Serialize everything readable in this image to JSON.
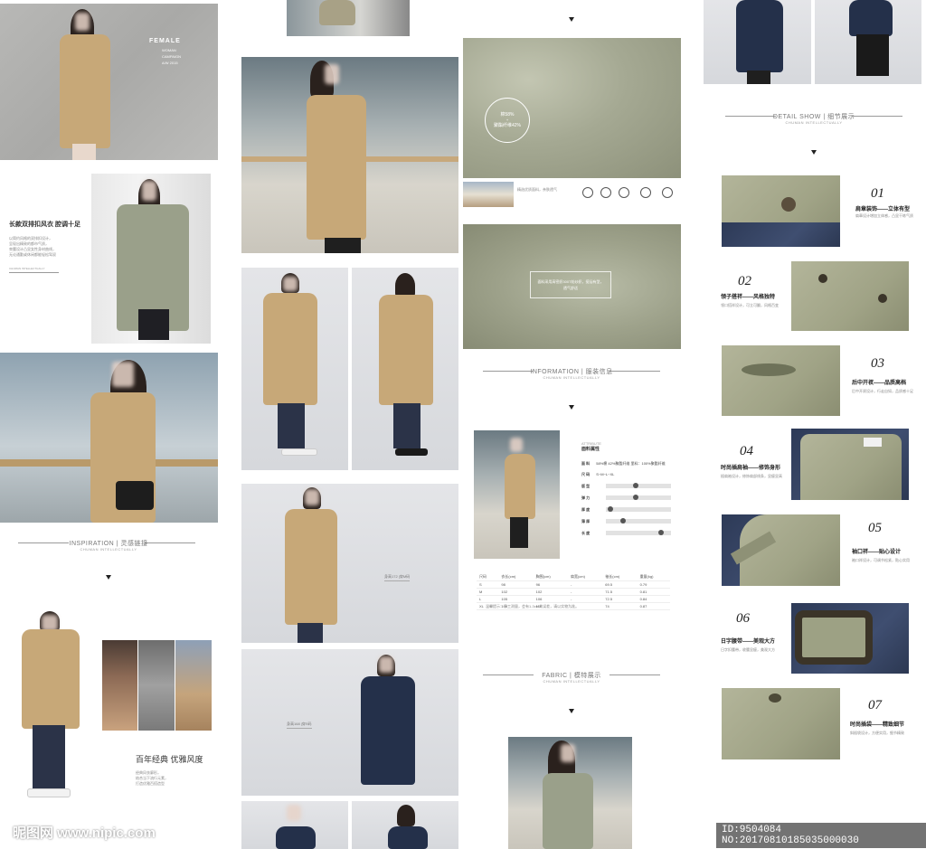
{
  "campaign": {
    "line1": "FEMALE",
    "line2": "WOMAN",
    "line3": "CAMPAIGN",
    "line4": "A/W 2015"
  },
  "intro": {
    "title": "长款双排扣风衣 腔调十足",
    "desc_lines": [
      "以简约风格的双排扣设计，",
      "呈现出精致的都市气质，",
      "束腰设计凸显女性身材曲线，",
      "无论通勤或休闲都能轻松驾驭"
    ],
    "brand_small": "CHUMAN INTELLECTUALLY"
  },
  "sections": {
    "inspiration": {
      "title": "INSPIRATION | 灵感链接",
      "sub": "CHUMAN INTELLECTUALLY"
    },
    "information": {
      "title": "INFORMATION | 服装信息",
      "sub": "CHUMAN INTELLECTUALLY"
    },
    "fabric": {
      "title": "FABRIC | 模特展示",
      "sub": "CHUMAN INTELLECTUALLY"
    },
    "detail": {
      "title": "DETAIL SHOW | 细节展示",
      "sub": "CHUMAN INTELLECTUALLY"
    }
  },
  "classic": {
    "title": "百年经典 优雅风度",
    "desc_lines": [
      "经典风衣廓形，",
      "结合当下流行元素，",
      "打造优雅百搭造型"
    ]
  },
  "fabric_info": {
    "cotton": "棉58%",
    "poly": "聚酯纤维42%",
    "fabric_note": "面料采用高密织300T纺纱织，挺括有型，透气舒适",
    "swatch_note": "精选优质面料，亲肤透气"
  },
  "model_tags": {
    "tag1": "身高172 |穿M码",
    "tag2": "身高168 |穿S码"
  },
  "product_info": {
    "title": "ATTRIBUTE",
    "subtitle": "面料属性",
    "rows": [
      {
        "label": "面  料",
        "value": "58%棉 42%聚酯纤维   里料：100%聚酯纤维"
      },
      {
        "label": "尺  码",
        "value": "S~M~L~XL"
      },
      {
        "label": "版  型",
        "value": ""
      },
      {
        "label": "弹  力",
        "value": ""
      },
      {
        "label": "厚  度",
        "value": ""
      },
      {
        "label": "薄  厚",
        "value": ""
      },
      {
        "label": "长  度",
        "value": ""
      }
    ],
    "size_table": {
      "headers": [
        "尺码",
        "衣长(cm)",
        "胸围(cm)",
        "肩宽(cm)",
        "袖长(cm)",
        "重量(kg)"
      ],
      "rows": [
        [
          "S",
          "98",
          "96",
          "-",
          "69.5",
          "0.79"
        ],
        [
          "M",
          "102",
          "102",
          "-",
          "71.5",
          "0.81"
        ],
        [
          "L",
          "105",
          "106",
          "-",
          "72.5",
          "0.84"
        ],
        [
          "XL",
          "108",
          "110",
          "-",
          "74",
          "0.87"
        ]
      ],
      "note": "温馨提示：手工测量，会有1-3cm的误差，请以实物为准。"
    }
  },
  "details": [
    {
      "num": "01",
      "title": "肩章装饰——立体有型",
      "desc": "肩章设计增加立体感，凸显干练气质"
    },
    {
      "num": "02",
      "title": "领子搭袢——风格独特",
      "desc": "领口搭袢设计，可立可翻，风格百变"
    },
    {
      "num": "03",
      "title": "后中开衩——品质高档",
      "desc": "后中开衩设计，行走自如，品质感十足"
    },
    {
      "num": "04",
      "title": "时尚插肩袖——修饰身形",
      "desc": "插肩袖设计，修饰肩部线条，显瘦显高"
    },
    {
      "num": "05",
      "title": "袖口袢——贴心设计",
      "desc": "袖口袢设计，可调节松紧，贴心实用"
    },
    {
      "num": "06",
      "title": "日字腰带——美观大方",
      "desc": "日字扣腰带，收腰显瘦，美观大方"
    },
    {
      "num": "07",
      "title": "时尚插袋——精致细节",
      "desc": "斜插袋设计，方便实用，细节精致"
    }
  ],
  "watermark": {
    "logo": "昵图网 www.nipic.com",
    "id": "ID:9504084 NO:20170810185035000030"
  },
  "colors": {
    "tan": "#c7a878",
    "sage": "#9aa08a",
    "navy": "#24304a",
    "fabric": "#a5a993"
  }
}
